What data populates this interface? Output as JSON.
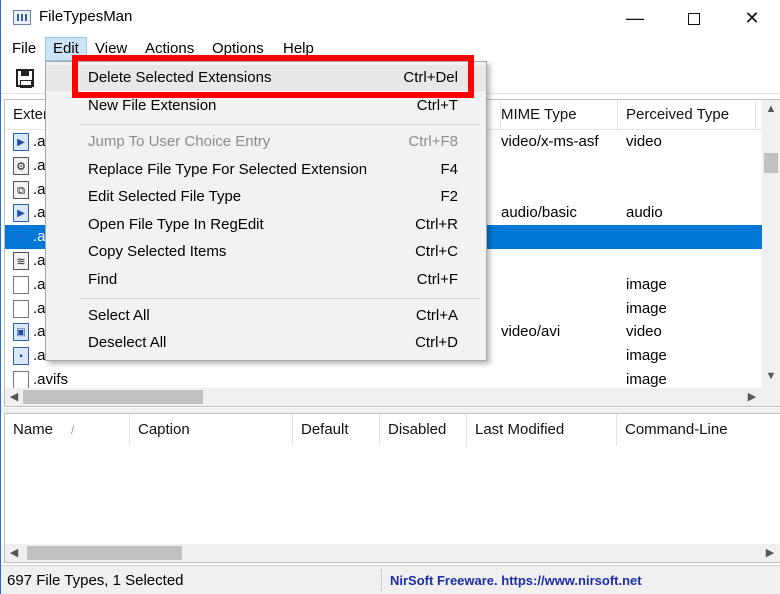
{
  "window": {
    "title": "FileTypesMan",
    "minimize_symbol": "—",
    "close_symbol": "✕"
  },
  "menubar": {
    "items": [
      "File",
      "Edit",
      "View",
      "Actions",
      "Options",
      "Help"
    ]
  },
  "toolbar": {
    "save_icon": "floppy-disk-icon"
  },
  "upper_list": {
    "columns": [
      "Exter",
      "MIME Type",
      "Perceived Type"
    ],
    "rows": [
      {
        "ext": ".a",
        "mime": "video/x-ms-asf",
        "perceived": "video",
        "icon": "media-file-icon"
      },
      {
        "ext": ".a",
        "mime": "",
        "perceived": "",
        "icon": "system-file-icon"
      },
      {
        "ext": ".a",
        "mime": "",
        "perceived": "",
        "icon": "system-file-icon"
      },
      {
        "ext": ".a",
        "mime": "audio/basic",
        "perceived": "audio",
        "icon": "media-file-icon"
      },
      {
        "ext": ".a",
        "mime": "",
        "perceived": "",
        "icon": "network-file-icon",
        "selected": true
      },
      {
        "ext": ".a",
        "mime": "",
        "perceived": "",
        "icon": "system-file-icon"
      },
      {
        "ext": ".a",
        "mime": "",
        "perceived": "image",
        "icon": "blank-file-icon"
      },
      {
        "ext": ".a",
        "mime": "",
        "perceived": "image",
        "icon": "blank-file-icon"
      },
      {
        "ext": ".a",
        "mime": "video/avi",
        "perceived": "video",
        "icon": "media-file-icon"
      },
      {
        "ext": ".a",
        "mime": "",
        "perceived": "image",
        "icon": "media-file-icon"
      },
      {
        "ext": ".avifs",
        "mime": "",
        "perceived": "image",
        "icon": "blank-file-icon"
      }
    ]
  },
  "lower_list": {
    "columns": [
      "Name",
      "Caption",
      "Default",
      "Disabled",
      "Last Modified",
      "Command-Line"
    ],
    "sort_indicator": "/"
  },
  "edit_menu": {
    "items": [
      {
        "label": "Delete Selected Extensions",
        "accel": "Ctrl+Del",
        "enabled": true
      },
      {
        "label": "New File Extension",
        "accel": "Ctrl+T",
        "enabled": true
      },
      {
        "label": "Jump To User Choice Entry",
        "accel": "Ctrl+F8",
        "enabled": false
      },
      {
        "label": "Replace File Type For Selected Extension",
        "accel": "F4",
        "enabled": true
      },
      {
        "label": "Edit Selected File Type",
        "accel": "F2",
        "enabled": true
      },
      {
        "label": "Open File Type In RegEdit",
        "accel": "Ctrl+R",
        "enabled": true
      },
      {
        "label": "Copy Selected Items",
        "accel": "Ctrl+C",
        "enabled": true
      },
      {
        "label": "Find",
        "accel": "Ctrl+F",
        "enabled": true
      },
      {
        "label": "Select All",
        "accel": "Ctrl+A",
        "enabled": true
      },
      {
        "label": "Deselect All",
        "accel": "Ctrl+D",
        "enabled": true
      }
    ]
  },
  "statusbar": {
    "left": "697 File Types, 1 Selected",
    "link": "NirSoft Freeware. https://www.nirsoft.net"
  },
  "colors": {
    "selection": "#0078d7",
    "annotation": "#ff0000",
    "link": "#1a2ea8"
  }
}
